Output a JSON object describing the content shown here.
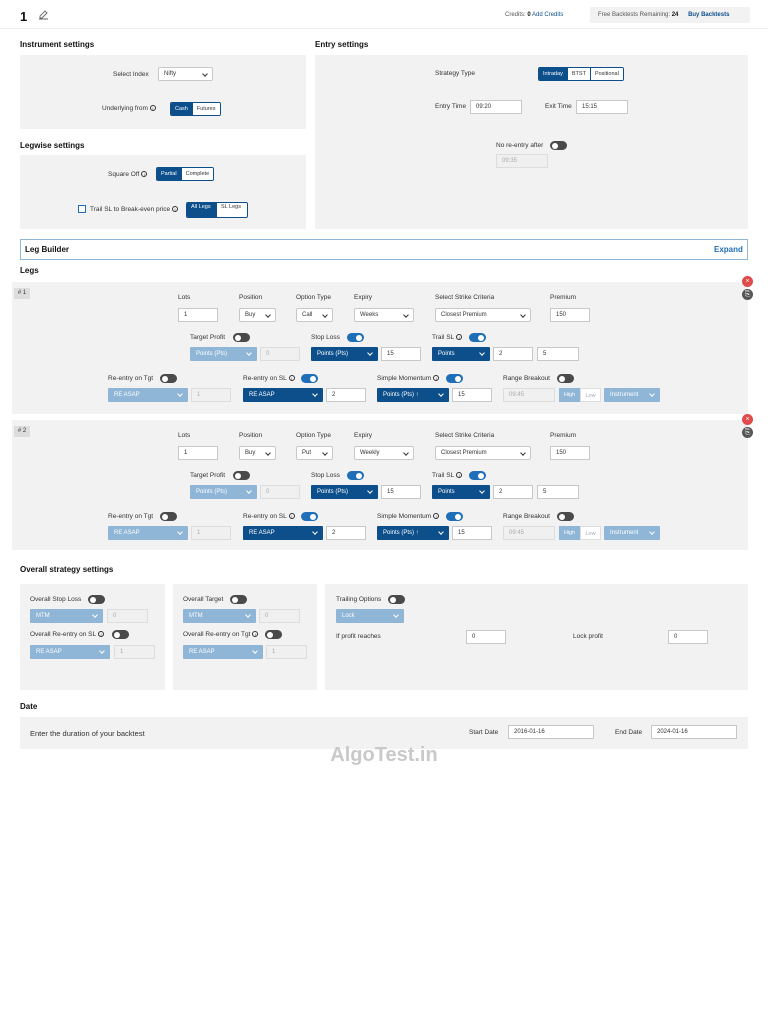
{
  "header": {
    "title": "1",
    "credits_label": "Credits:",
    "credits_value": "0",
    "add_credits": "Add Credits",
    "free_label": "Free Backtests Remaining:",
    "free_value": "24",
    "buy_label": "Buy Backtests"
  },
  "instrument": {
    "title": "Instrument settings",
    "select_index_label": "Select Index",
    "index_value": "Nifty",
    "underlying_label": "Underlying from",
    "underlying_options": [
      "Cash",
      "Futures"
    ]
  },
  "entry": {
    "title": "Entry settings",
    "strategy_type_label": "Strategy Type",
    "strategy_options": [
      "Intraday",
      "BTST",
      "Positional"
    ],
    "entry_time_label": "Entry Time",
    "entry_time": "09:20",
    "exit_time_label": "Exit Time",
    "exit_time": "15:15",
    "no_reentry_label": "No re-entry after",
    "no_reentry_time": "09:35"
  },
  "legwise": {
    "title": "Legwise settings",
    "square_off_label": "Square Off",
    "square_off_options": [
      "Partial",
      "Complete"
    ],
    "trail_label": "Trail SL to Break-even price",
    "trail_options": [
      "All Legs",
      "SL Legs"
    ]
  },
  "leg_builder": {
    "title": "Leg Builder",
    "expand": "Expand"
  },
  "legs_title": "Legs",
  "labels": {
    "lots": "Lots",
    "position": "Position",
    "option_type": "Option Type",
    "expiry": "Expiry",
    "strike": "Select Strike Criteria",
    "premium": "Premium",
    "target_profit": "Target Profit",
    "stop_loss": "Stop Loss",
    "trail_sl": "Trail SL",
    "reentry_tgt": "Re-entry on Tgt",
    "reentry_sl": "Re-entry on SL",
    "simple_momentum": "Simple Momentum",
    "range_breakout": "Range Breakout"
  },
  "legs": [
    {
      "num": "# 1",
      "lots": "1",
      "position": "Buy",
      "option_type": "Call",
      "expiry": "Weeks",
      "strike": "Closest Premium",
      "premium": "150",
      "tp_type": "Points (Pts)",
      "tp_val": "0",
      "sl_type": "Points (Pts)",
      "sl_val": "15",
      "trail_type": "Points",
      "trail_x": "2",
      "trail_y": "5",
      "rt_type": "RE ASAP",
      "rt_val": "1",
      "rs_type": "RE ASAP",
      "rs_val": "2",
      "sm_type": "Points (Pts) ↑",
      "sm_val": "15",
      "rb_time": "09:45",
      "rb_high": "High",
      "rb_low": "Low",
      "rb_instr": "Instrument"
    },
    {
      "num": "# 2",
      "lots": "1",
      "position": "Buy",
      "option_type": "Put",
      "expiry": "Weekly",
      "strike": "Closest Premium",
      "premium": "150",
      "tp_type": "Points (Pts)",
      "tp_val": "0",
      "sl_type": "Points (Pts)",
      "sl_val": "15",
      "trail_type": "Points",
      "trail_x": "2",
      "trail_y": "5",
      "rt_type": "RE ASAP",
      "rt_val": "1",
      "rs_type": "RE ASAP",
      "rs_val": "2",
      "sm_type": "Points (Pts) ↑",
      "sm_val": "15",
      "rb_time": "09:45",
      "rb_high": "High",
      "rb_low": "Low",
      "rb_instr": "Instrument"
    }
  ],
  "overall": {
    "title": "Overall strategy settings",
    "sl_label": "Overall Stop Loss",
    "sl_type": "MTM",
    "sl_val": "0",
    "reentry_sl_label": "Overall Re-entry on SL",
    "reentry_sl_type": "RE ASAP",
    "reentry_sl_val": "1",
    "target_label": "Overall Target",
    "target_type": "MTM",
    "target_val": "0",
    "reentry_tgt_label": "Overall Re-entry on Tgt",
    "reentry_tgt_type": "RE ASAP",
    "reentry_tgt_val": "1",
    "trailing_label": "Trailing Options",
    "trailing_type": "Lock",
    "profit_reaches_label": "If profit reaches",
    "profit_reaches_val": "0",
    "lock_profit_label": "Lock profit",
    "lock_profit_val": "0"
  },
  "date": {
    "title": "Date",
    "prompt": "Enter the duration of your backtest",
    "start_label": "Start Date",
    "start": "2016-01-16",
    "end_label": "End Date",
    "end": "2024-01-16"
  },
  "watermark": "AlgoTest.in"
}
